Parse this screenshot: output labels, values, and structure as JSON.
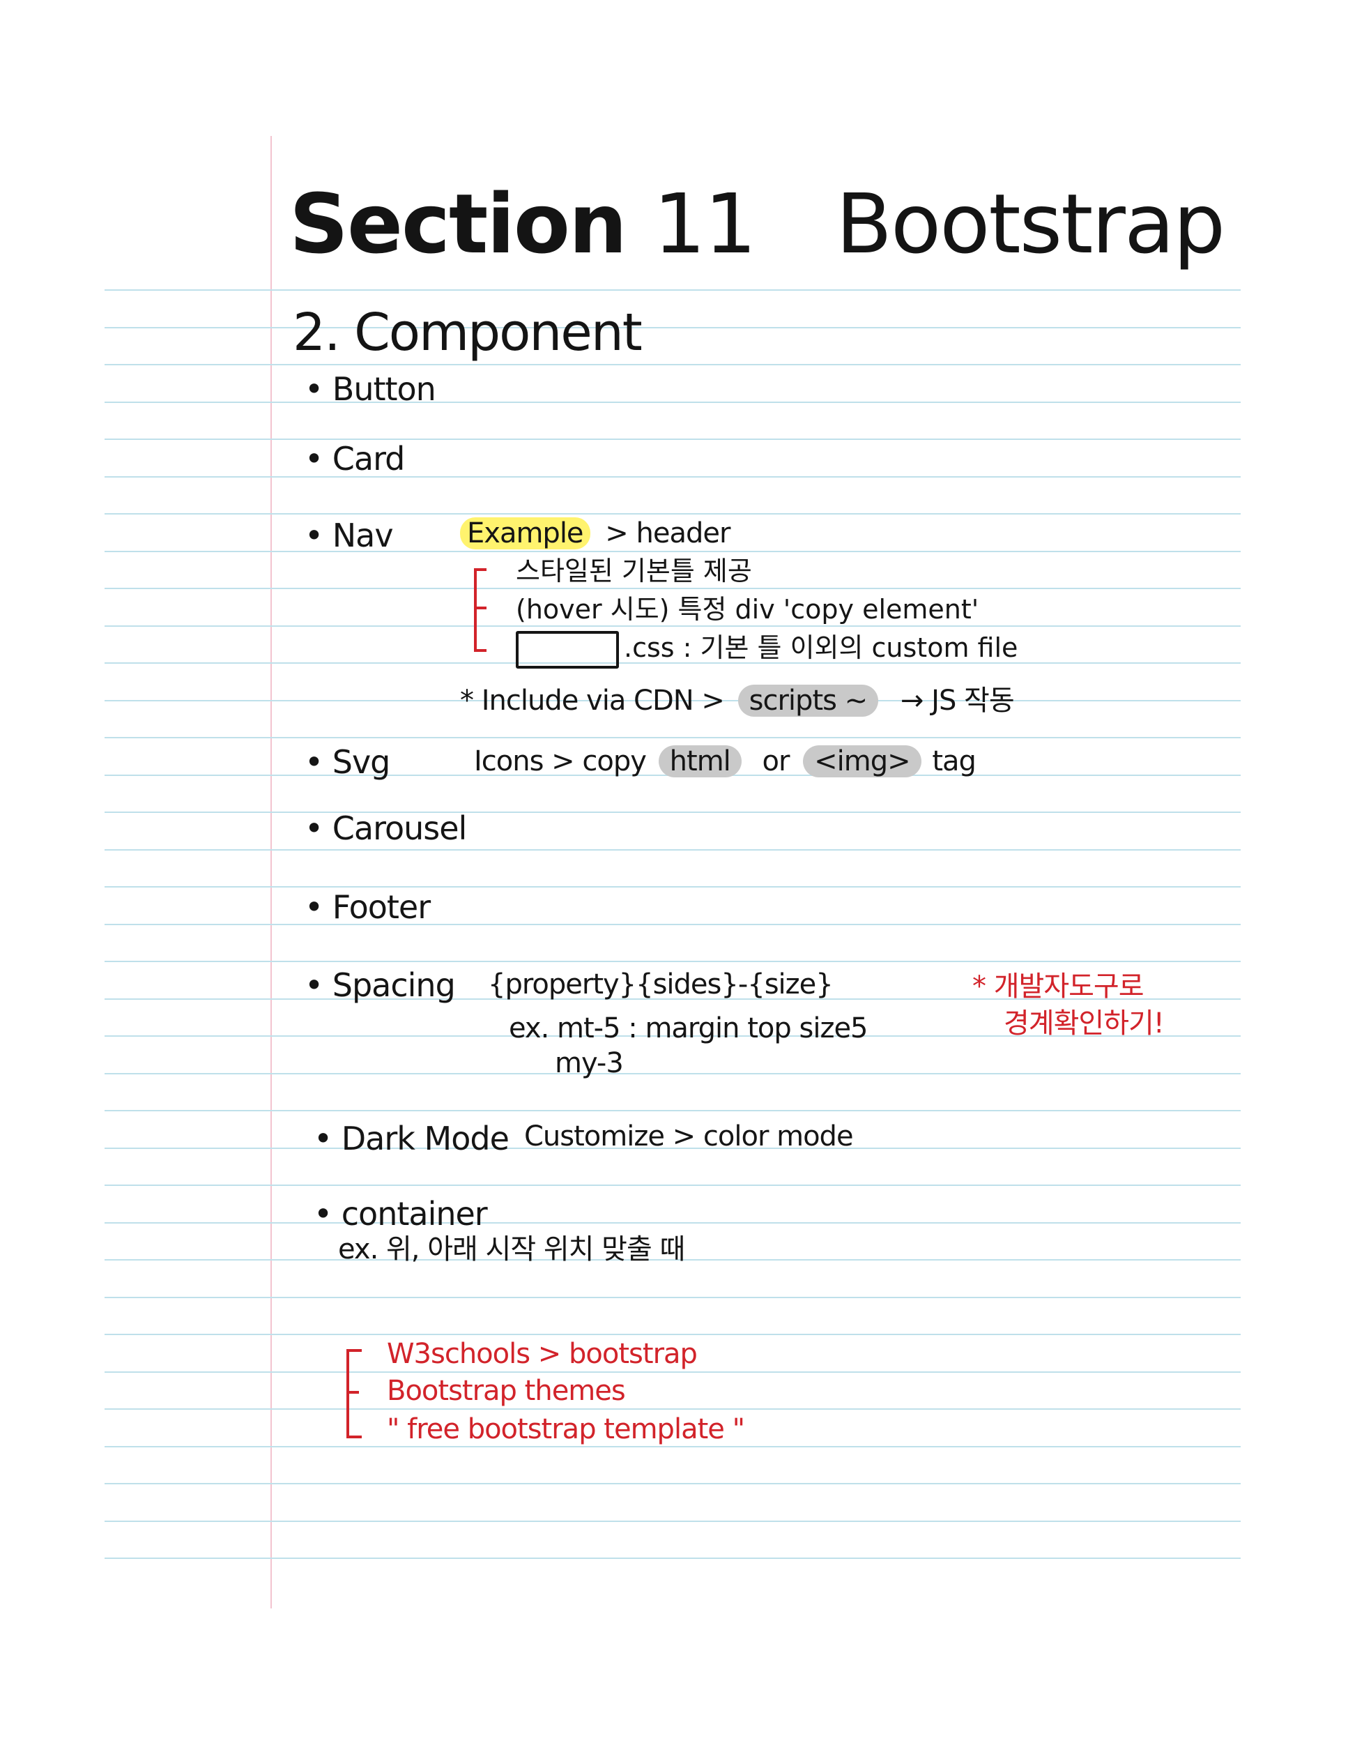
{
  "title": {
    "part1": "Section",
    "part2": "11",
    "part3": "Bootstrap"
  },
  "subtitle": "2. Component",
  "items": {
    "button": "• Button",
    "card": "• Card",
    "nav": "• Nav",
    "svg": "• Svg",
    "carousel": "• Carousel",
    "footer": "• Footer",
    "spacing": "• Spacing",
    "dark_mode": "• Dark Mode",
    "container": "• container"
  },
  "nav_notes": {
    "example": "Example",
    "arrow_header": "> header",
    "line1": "스타일된 기본틀 제공",
    "line2": "(hover 시도) 특정 div 'copy element'",
    "line3": ".css : 기본 틀 이외의 custom file",
    "cdn_prefix": "* Include via CDN >",
    "cdn_scripts": "scripts ~",
    "cdn_suffix": "→ JS 작동"
  },
  "svg_notes": {
    "prefix": "Icons > copy",
    "html": "html",
    "or": "or",
    "img": "<img>",
    "tag": "tag"
  },
  "spacing_notes": {
    "formula": "{property}{sides}-{size}",
    "example1": "ex. mt-5   : margin top size5",
    "example2": "my-3",
    "red_note_line1": "* 개발자도구로",
    "red_note_line2": "경계확인하기!"
  },
  "dark_mode_notes": "Customize > color mode",
  "container_notes": "ex. 위, 아래 시작 위치 맞출 때",
  "resources": {
    "line1": "W3schools > bootstrap",
    "line2": "Bootstrap themes",
    "line3": "\" free  bootstrap  template \""
  },
  "colors": {
    "ink": "#151515",
    "red_ink": "#d2232a",
    "highlight_yellow": "#fff36e",
    "highlight_gray": "#c9c9c9",
    "ruled_line": "#bfe0ea",
    "margin_line": "#f3c4cf"
  }
}
